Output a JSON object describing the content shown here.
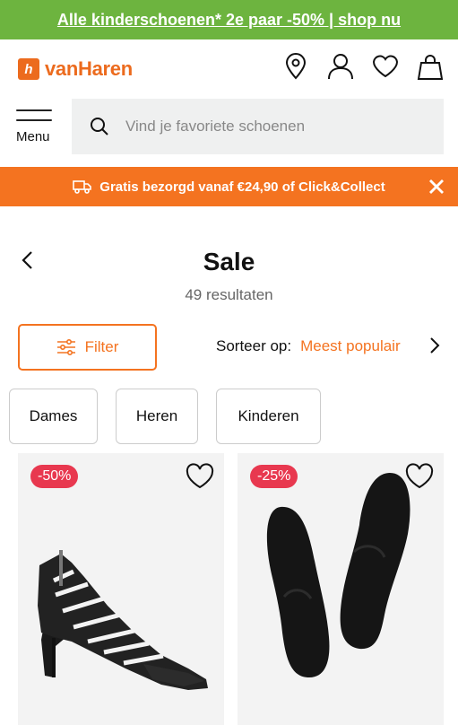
{
  "promo": {
    "text": "Alle kinderschoenen* 2e paar -50% | shop nu"
  },
  "header": {
    "logo_text": "vanHaren",
    "logo_mark": "h",
    "icons": [
      "location-pin-icon",
      "user-icon",
      "heart-icon",
      "shopping-bag-icon"
    ]
  },
  "menu": {
    "label": "Menu"
  },
  "search": {
    "placeholder": "Vind je favoriete schoenen"
  },
  "shipping": {
    "text": "Gratis bezorgd vanaf €24,90 of Click&Collect"
  },
  "page": {
    "title": "Sale",
    "result_count": "49 resultaten"
  },
  "filter": {
    "label": "Filter"
  },
  "sort": {
    "label": "Sorteer op:",
    "value": "Meest populair"
  },
  "chips": [
    "Dames",
    "Heren",
    "Kinderen"
  ],
  "products": [
    {
      "badge": "-50%",
      "image": "black-glitter-strappy-heel"
    },
    {
      "badge": "-25%",
      "image": "black-insoles"
    }
  ],
  "colors": {
    "accent": "#f47320",
    "promo_green": "#6db43f",
    "badge_red": "#e8384f"
  }
}
